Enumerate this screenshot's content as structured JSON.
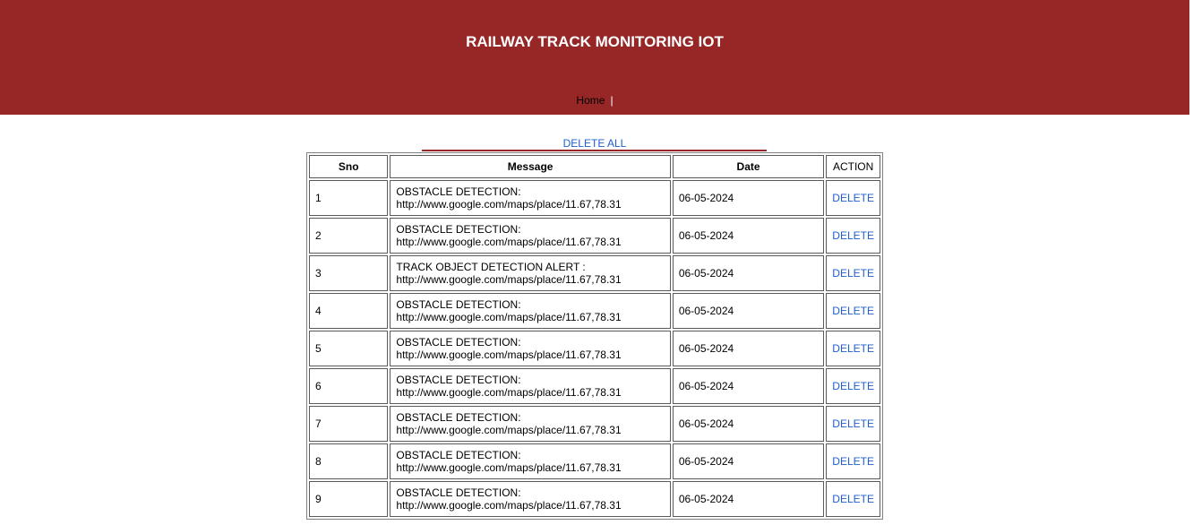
{
  "header": {
    "title": "RAILWAY TRACK MONITORING IOT"
  },
  "nav": {
    "home": "Home",
    "separator": "|"
  },
  "delete_all": "DELETE ALL",
  "table": {
    "columns": [
      "Sno",
      "Message",
      "Date",
      "ACTION"
    ],
    "rows": [
      {
        "sno": "1",
        "line1": "OBSTACLE DETECTION:",
        "line2": "http://www.google.com/maps/place/11.67,78.31",
        "date": "06-05-2024",
        "action": "DELETE"
      },
      {
        "sno": "2",
        "line1": "OBSTACLE DETECTION:",
        "line2": "http://www.google.com/maps/place/11.67,78.31",
        "date": "06-05-2024",
        "action": "DELETE"
      },
      {
        "sno": "3",
        "line1": "TRACK OBJECT DETECTION ALERT :",
        "line2": "http://www.google.com/maps/place/11.67,78.31",
        "date": "06-05-2024",
        "action": "DELETE"
      },
      {
        "sno": "4",
        "line1": "OBSTACLE DETECTION:",
        "line2": "http://www.google.com/maps/place/11.67,78.31",
        "date": "06-05-2024",
        "action": "DELETE"
      },
      {
        "sno": "5",
        "line1": "OBSTACLE DETECTION:",
        "line2": "http://www.google.com/maps/place/11.67,78.31",
        "date": "06-05-2024",
        "action": "DELETE"
      },
      {
        "sno": "6",
        "line1": "OBSTACLE DETECTION:",
        "line2": "http://www.google.com/maps/place/11.67,78.31",
        "date": "06-05-2024",
        "action": "DELETE"
      },
      {
        "sno": "7",
        "line1": "OBSTACLE DETECTION:",
        "line2": "http://www.google.com/maps/place/11.67,78.31",
        "date": "06-05-2024",
        "action": "DELETE"
      },
      {
        "sno": "8",
        "line1": "OBSTACLE DETECTION:",
        "line2": "http://www.google.com/maps/place/11.67,78.31",
        "date": "06-05-2024",
        "action": "DELETE"
      },
      {
        "sno": "9",
        "line1": "OBSTACLE DETECTION:",
        "line2": "http://www.google.com/maps/place/11.67,78.31",
        "date": "06-05-2024",
        "action": "DELETE"
      }
    ]
  },
  "colors": {
    "header_bg": "#962726",
    "link": "#1f5fd1"
  }
}
